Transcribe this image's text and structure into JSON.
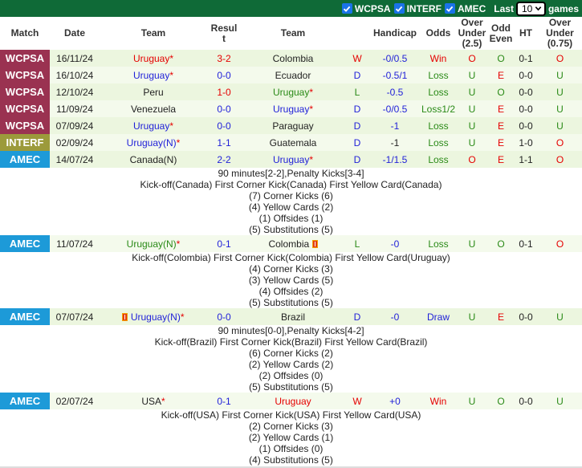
{
  "filters": {
    "items": [
      {
        "label": "WCPSA",
        "checked": true
      },
      {
        "label": "INTERF",
        "checked": true
      },
      {
        "label": "AMEC",
        "checked": true
      }
    ],
    "last_label": "Last",
    "last_value": "10",
    "games_label": "games"
  },
  "headers": {
    "match": "Match",
    "date": "Date",
    "team_home": "Team",
    "result_l1": "Resul",
    "result_l2": "t",
    "team_away": "Team",
    "handicap": "Handicap",
    "odds": "Odds",
    "ou_l1": "Over",
    "ou_l2": "Under",
    "ou_l3": "(2.5)",
    "oe_l1": "Odd",
    "oe_l2": "Even",
    "ht": "HT",
    "ou2_l1": "Over",
    "ou2_l2": "Under",
    "ou2_l3": "(0.75)"
  },
  "colors": {
    "WCPSA": "#9a3251",
    "INTERF": "#9c9a3b",
    "AMEC": "#1d9ad8",
    "header_bar": "#0f6a37",
    "win_red": "#e50000",
    "draw_blue": "#1f1fd8",
    "loss_green": "#2a8a17"
  },
  "matches": [
    {
      "league": "WCPSA",
      "date": "16/11/24",
      "home": "Uruguay",
      "home_star": "*",
      "home_color": "red",
      "score": "3-2",
      "score_color": "red",
      "away": "Colombia",
      "away_star": "",
      "away_color": "dark",
      "wdl": "W",
      "wdl_color": "red",
      "handicap": "-0/0.5",
      "hc_color": "blue",
      "odds": "Win",
      "odds_color": "red",
      "ou": "O",
      "ou_color": "red",
      "oe": "O",
      "oe_color": "green",
      "ht": "0-1",
      "ou2": "O",
      "ou2_color": "red"
    },
    {
      "league": "WCPSA",
      "date": "16/10/24",
      "home": "Uruguay",
      "home_star": "*",
      "home_color": "blue",
      "score": "0-0",
      "score_color": "blue",
      "away": "Ecuador",
      "away_star": "",
      "away_color": "dark",
      "wdl": "D",
      "wdl_color": "blue",
      "handicap": "-0.5/1",
      "hc_color": "blue",
      "odds": "Loss",
      "odds_color": "green",
      "ou": "U",
      "ou_color": "green",
      "oe": "E",
      "oe_color": "red",
      "ht": "0-0",
      "ou2": "U",
      "ou2_color": "green"
    },
    {
      "league": "WCPSA",
      "date": "12/10/24",
      "home": "Peru",
      "home_star": "",
      "home_color": "dark",
      "score": "1-0",
      "score_color": "red",
      "away": "Uruguay",
      "away_star": "*",
      "away_color": "green",
      "wdl": "L",
      "wdl_color": "green",
      "handicap": "-0.5",
      "hc_color": "blue",
      "odds": "Loss",
      "odds_color": "green",
      "ou": "U",
      "ou_color": "green",
      "oe": "O",
      "oe_color": "green",
      "ht": "0-0",
      "ou2": "U",
      "ou2_color": "green"
    },
    {
      "league": "WCPSA",
      "date": "11/09/24",
      "home": "Venezuela",
      "home_star": "",
      "home_color": "dark",
      "score": "0-0",
      "score_color": "blue",
      "away": "Uruguay",
      "away_star": "*",
      "away_color": "blue",
      "wdl": "D",
      "wdl_color": "blue",
      "handicap": "-0/0.5",
      "hc_color": "blue",
      "odds": "Loss1/2",
      "odds_color": "green",
      "ou": "U",
      "ou_color": "green",
      "oe": "E",
      "oe_color": "red",
      "ht": "0-0",
      "ou2": "U",
      "ou2_color": "green"
    },
    {
      "league": "WCPSA",
      "date": "07/09/24",
      "home": "Uruguay",
      "home_star": "*",
      "home_color": "blue",
      "score": "0-0",
      "score_color": "blue",
      "away": "Paraguay",
      "away_star": "",
      "away_color": "dark",
      "wdl": "D",
      "wdl_color": "blue",
      "handicap": "-1",
      "hc_color": "blue",
      "odds": "Loss",
      "odds_color": "green",
      "ou": "U",
      "ou_color": "green",
      "oe": "E",
      "oe_color": "red",
      "ht": "0-0",
      "ou2": "U",
      "ou2_color": "green"
    },
    {
      "league": "INTERF",
      "date": "02/09/24",
      "home": "Uruguay(N)",
      "home_star": "*",
      "home_color": "blue",
      "score": "1-1",
      "score_color": "blue",
      "away": "Guatemala",
      "away_star": "",
      "away_color": "dark",
      "wdl": "D",
      "wdl_color": "blue",
      "handicap": "-1",
      "hc_color": "dark",
      "odds": "Loss",
      "odds_color": "green",
      "ou": "U",
      "ou_color": "green",
      "oe": "E",
      "oe_color": "red",
      "ht": "1-0",
      "ou2": "O",
      "ou2_color": "red"
    },
    {
      "league": "AMEC",
      "date": "14/07/24",
      "home": "Canada(N)",
      "home_star": "",
      "home_color": "dark",
      "score": "2-2",
      "score_color": "blue",
      "away": "Uruguay",
      "away_star": "*",
      "away_color": "blue",
      "wdl": "D",
      "wdl_color": "blue",
      "handicap": "-1/1.5",
      "hc_color": "blue",
      "odds": "Loss",
      "odds_color": "green",
      "ou": "O",
      "ou_color": "red",
      "oe": "E",
      "oe_color": "red",
      "ht": "1-1",
      "ou2": "O",
      "ou2_color": "red",
      "details": [
        "90 minutes[2-2],Penalty Kicks[3-4]",
        "Kick-off(Canada)  First Corner Kick(Canada)  First Yellow Card(Canada)",
        "(7) Corner Kicks (6)",
        "(4) Yellow Cards (2)",
        "(1) Offsides (1)",
        "(5) Substitutions (5)"
      ]
    },
    {
      "league": "AMEC",
      "date": "11/07/24",
      "home": "Uruguay(N)",
      "home_star": "*",
      "home_color": "green",
      "score": "0-1",
      "score_color": "blue",
      "away": "Colombia",
      "away_star": "",
      "away_color": "dark",
      "away_redcard": true,
      "wdl": "L",
      "wdl_color": "green",
      "handicap": "-0",
      "hc_color": "blue",
      "odds": "Loss",
      "odds_color": "green",
      "ou": "U",
      "ou_color": "green",
      "oe": "O",
      "oe_color": "green",
      "ht": "0-1",
      "ou2": "O",
      "ou2_color": "red",
      "details": [
        "Kick-off(Colombia)  First Corner Kick(Colombia)  First Yellow Card(Uruguay)",
        "(4) Corner Kicks (3)",
        "(3) Yellow Cards (5)",
        "(4) Offsides (2)",
        "(5) Substitutions (5)"
      ]
    },
    {
      "league": "AMEC",
      "date": "07/07/24",
      "home": "Uruguay(N)",
      "home_star": "*",
      "home_color": "blue",
      "home_redcard": true,
      "score": "0-0",
      "score_color": "blue",
      "away": "Brazil",
      "away_star": "",
      "away_color": "dark",
      "wdl": "D",
      "wdl_color": "blue",
      "handicap": "-0",
      "hc_color": "blue",
      "odds": "Draw",
      "odds_color": "blue",
      "ou": "U",
      "ou_color": "green",
      "oe": "E",
      "oe_color": "red",
      "ht": "0-0",
      "ou2": "U",
      "ou2_color": "green",
      "details": [
        "90 minutes[0-0],Penalty Kicks[4-2]",
        "Kick-off(Brazil)  First Corner Kick(Brazil)  First Yellow Card(Brazil)",
        "(6) Corner Kicks (2)",
        "(2) Yellow Cards (2)",
        "(2) Offsides (0)",
        "(5) Substitutions (5)"
      ]
    },
    {
      "league": "AMEC",
      "date": "02/07/24",
      "home": "USA",
      "home_star": "*",
      "home_color": "dark",
      "score": "0-1",
      "score_color": "blue",
      "away": "Uruguay",
      "away_star": "",
      "away_color": "red",
      "wdl": "W",
      "wdl_color": "red",
      "handicap": "+0",
      "hc_color": "blue",
      "odds": "Win",
      "odds_color": "red",
      "ou": "U",
      "ou_color": "green",
      "oe": "O",
      "oe_color": "green",
      "ht": "0-0",
      "ou2": "U",
      "ou2_color": "green",
      "details": [
        "Kick-off(USA)  First Corner Kick(USA)  First Yellow Card(USA)",
        "(2) Corner Kicks (3)",
        "(2) Yellow Cards (1)",
        "(1) Offsides (0)",
        "(4) Substitutions (5)"
      ]
    }
  ]
}
